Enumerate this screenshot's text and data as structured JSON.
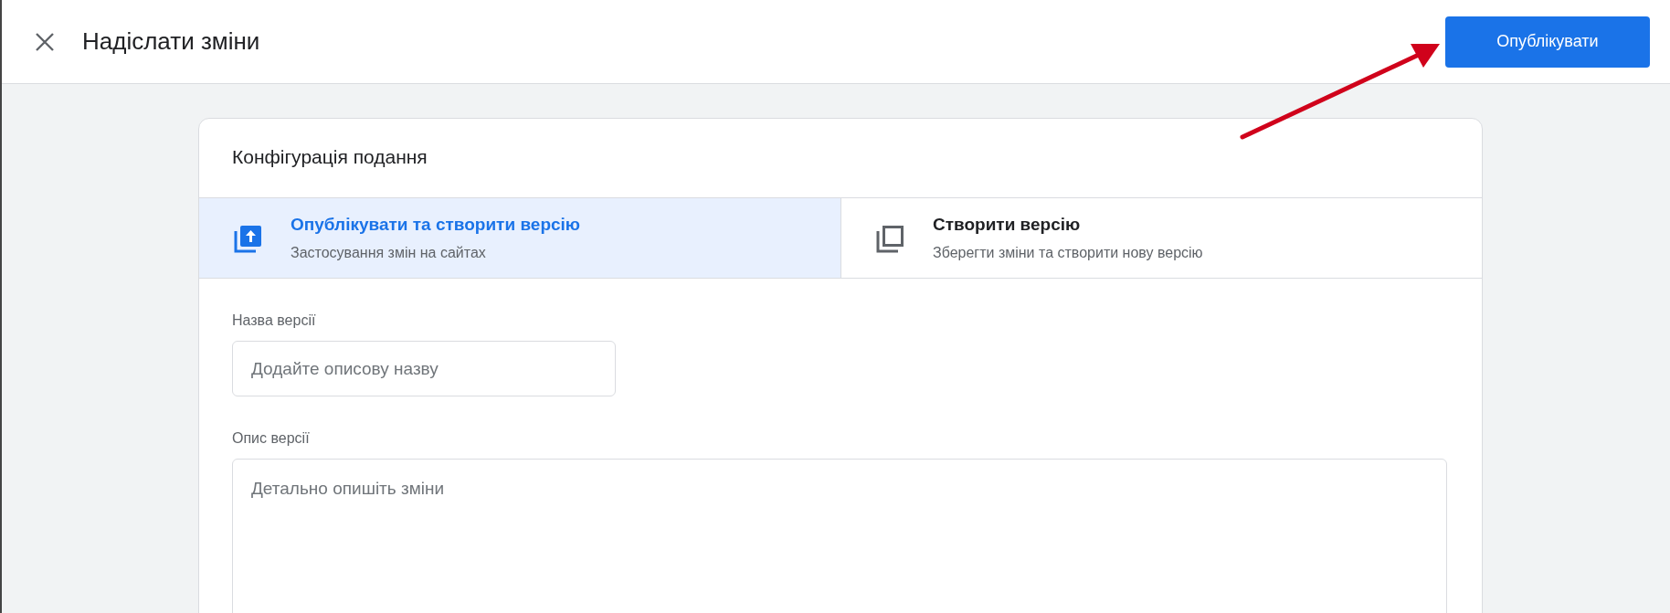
{
  "header": {
    "title": "Надіслати зміни",
    "publish_button": "Опублікувати"
  },
  "card": {
    "title": "Конфігурація подання",
    "options": [
      {
        "kind": "publish",
        "title": "Опублікувати та створити версію",
        "subtitle": "Застосування змін на сайтах",
        "selected": true
      },
      {
        "kind": "version",
        "title": "Створити версію",
        "subtitle": "Зберегти зміни та створити нову версію",
        "selected": false
      }
    ],
    "fields": [
      {
        "kind": "input",
        "label": "Назва версії",
        "placeholder": "Додайте описову назву"
      },
      {
        "kind": "textarea",
        "label": "Опис версії",
        "placeholder": "Детально опишіть зміни"
      }
    ]
  }
}
